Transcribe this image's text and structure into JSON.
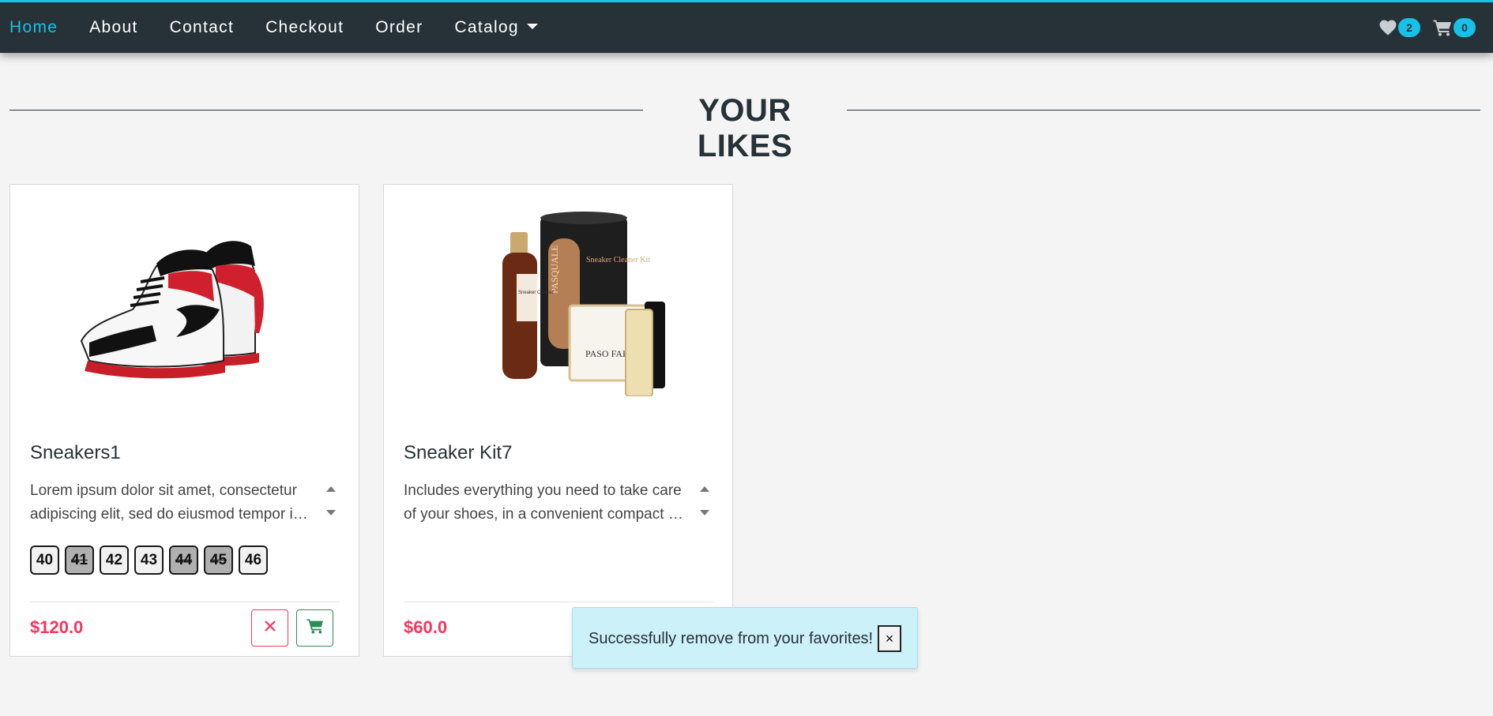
{
  "nav": {
    "items": [
      {
        "label": "Home",
        "active": true
      },
      {
        "label": "About"
      },
      {
        "label": "Contact"
      },
      {
        "label": "Checkout"
      },
      {
        "label": "Order"
      },
      {
        "label": "Catalog"
      }
    ],
    "favorites_count": "2",
    "cart_count": "0"
  },
  "page": {
    "title": "YOUR LIKES"
  },
  "products": [
    {
      "name": "Sneakers1",
      "desc_line1": "Lorem ipsum dolor sit amet, consectetur",
      "desc_line2": "adipiscing elit, sed do eiusmod tempor incididunt",
      "sizes": [
        {
          "label": "40",
          "available": true
        },
        {
          "label": "41",
          "available": false
        },
        {
          "label": "42",
          "available": true
        },
        {
          "label": "43",
          "available": true
        },
        {
          "label": "44",
          "available": false
        },
        {
          "label": "45",
          "available": false
        },
        {
          "label": "46",
          "available": true
        }
      ],
      "price": "$120.0",
      "image_icon": "sneakers-image"
    },
    {
      "name": "Sneaker Kit7",
      "desc_line1": "Includes everything you need to take care",
      "desc_line2": "of your shoes, in a convenient compact case",
      "price": "$60.0",
      "image_icon": "sneaker-cleaner-kit-image",
      "image_labels": {
        "bottle": "Sneaker Cleaner",
        "tube": "Sneaker Cleaner Kit",
        "brand": "PASQUALE",
        "cloth": "PASO FAR"
      }
    }
  ],
  "toast": {
    "message": "Successfully remove from your favorites!",
    "close_label": "×"
  },
  "colors": {
    "navbar": "#263238",
    "accent": "#17c1e8",
    "price": "#f5365c",
    "remove": "#f5365c",
    "cart": "#2e8b57",
    "toast_bg": "#cdf1f8"
  }
}
